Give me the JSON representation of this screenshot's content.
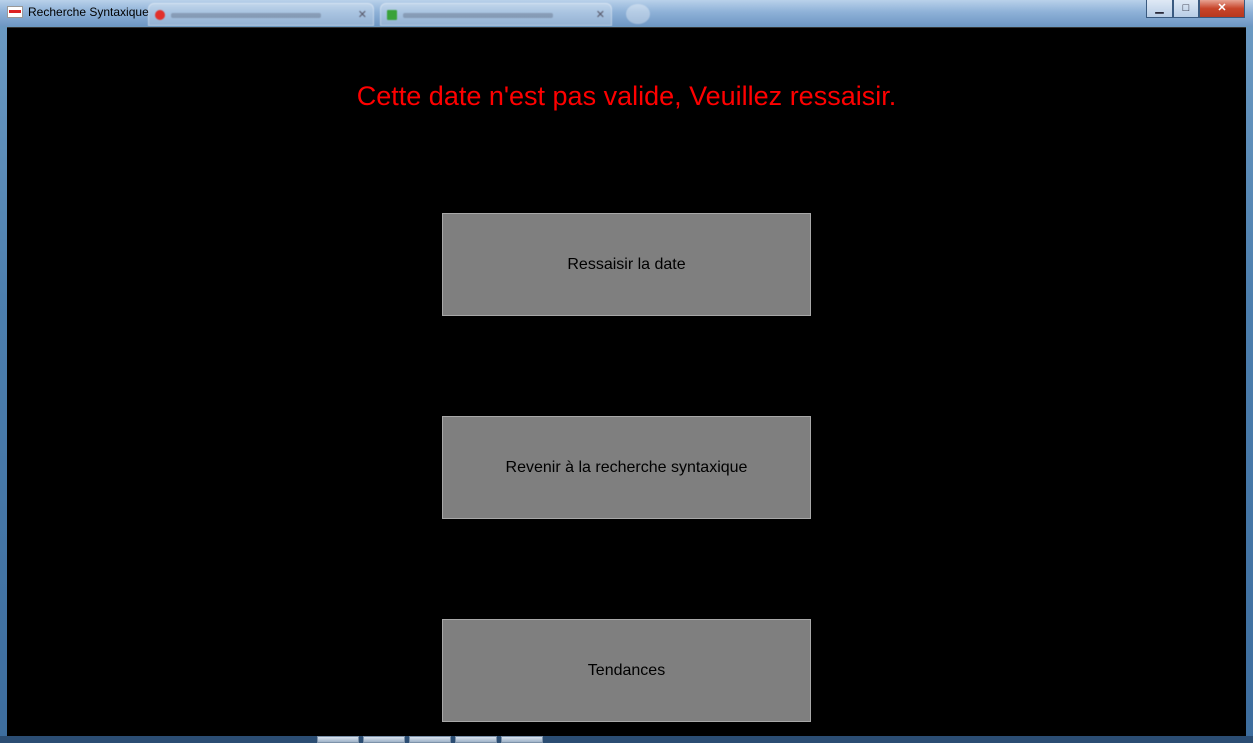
{
  "window": {
    "title": "Recherche Syntaxique",
    "minimize_symbol": "▁",
    "maximize_symbol": "□",
    "close_symbol": "✕"
  },
  "background_tabs": [
    {
      "icon_color": "#e2302b"
    },
    {
      "icon_color": "#3aa23a"
    }
  ],
  "content": {
    "error_message": "Cette date n'est pas valide, Veuillez ressaisir.",
    "error_color": "#ff0000",
    "buttons": [
      {
        "label": "Ressaisir la date"
      },
      {
        "label": "Revenir à la recherche syntaxique"
      },
      {
        "label": "Tendances"
      }
    ]
  },
  "colors": {
    "content_background": "#000000",
    "button_background": "#7f7f7f"
  }
}
